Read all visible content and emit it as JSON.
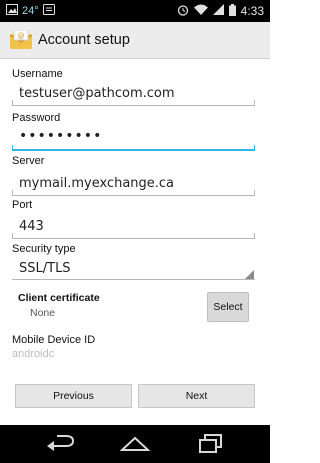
{
  "status_bar": {
    "temperature": "24°",
    "time": "4:33",
    "icons": [
      "photo-icon",
      "notification-icon",
      "alarm-icon",
      "wifi-icon",
      "signal-icon",
      "battery-icon"
    ]
  },
  "action_bar": {
    "title": "Account setup",
    "icon": "email-app-icon"
  },
  "form": {
    "username": {
      "label": "Username",
      "value": "testuser@pathcom.com"
    },
    "password": {
      "label": "Password",
      "value": "•••••••••"
    },
    "server": {
      "label": "Server",
      "value": "mymail.myexchange.ca"
    },
    "port": {
      "label": "Port",
      "value": "443"
    },
    "security_type": {
      "label": "Security type",
      "value": "SSL/TLS"
    },
    "client_certificate": {
      "label": "Client certificate",
      "value": "None",
      "select_label": "Select"
    },
    "mobile_device_id": {
      "label": "Mobile Device ID",
      "value": "androidc"
    }
  },
  "buttons": {
    "previous": "Previous",
    "next": "Next"
  },
  "nav_bar": {
    "icons": [
      "back-icon",
      "home-icon",
      "recents-icon"
    ]
  },
  "colors": {
    "accent": "#33b5e5",
    "action_bar_bg": "#ececec",
    "status_bar_bg": "#000000"
  }
}
